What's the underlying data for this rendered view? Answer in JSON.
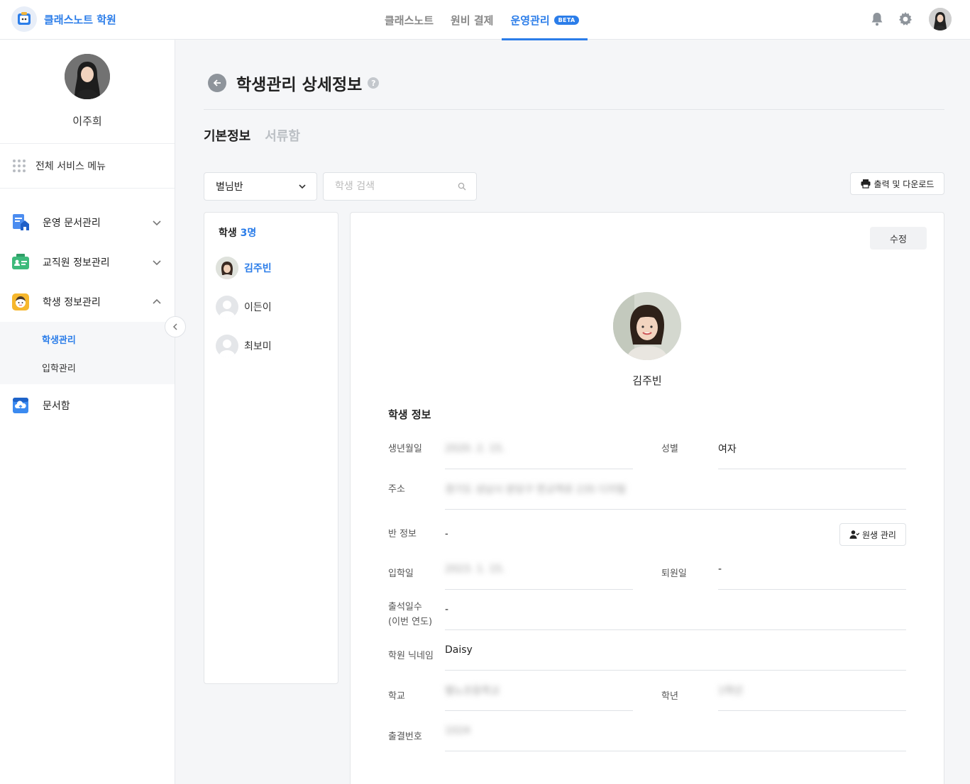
{
  "header": {
    "brand_name": "클래스노트 학원",
    "nav": [
      {
        "label": "클래스노트"
      },
      {
        "label": "원비 결제"
      },
      {
        "label": "운영관리"
      }
    ],
    "beta_badge": "BETA"
  },
  "sidebar": {
    "user_name": "이주희",
    "all_menu": "전체 서비스 메뉴",
    "items": [
      {
        "label": "운영 문서관리"
      },
      {
        "label": "교직원 정보관리"
      },
      {
        "label": "학생 정보관리"
      },
      {
        "label": "문서함"
      }
    ],
    "sub_items": [
      {
        "label": "학생관리"
      },
      {
        "label": "입학관리"
      }
    ]
  },
  "page": {
    "title": "학생관리 상세정보",
    "help": "?",
    "tabs": [
      {
        "label": "기본정보"
      },
      {
        "label": "서류함"
      }
    ],
    "class_filter": "별님반",
    "search_placeholder": "학생 검색",
    "print_button": "출력 및 다운로드"
  },
  "student_list": {
    "header_prefix": "학생",
    "count": "3명",
    "students": [
      {
        "name": "김주빈"
      },
      {
        "name": "이든이"
      },
      {
        "name": "최보미"
      }
    ]
  },
  "detail": {
    "edit_button": "수정",
    "name": "김주빈",
    "section_title": "학생 정보",
    "fields": {
      "birth_label": "생년월일",
      "birth_value": "2020. 2. 15.",
      "gender_label": "성별",
      "gender_value": "여자",
      "address_label": "주소",
      "address_value": "경기도 성남시 분당구 판교역로 235 디지털",
      "class_label": "반 정보",
      "class_value": "-",
      "class_mgmt_button": "원생 관리",
      "enroll_label": "입학일",
      "enroll_value": "2023. 1. 15.",
      "leave_label": "퇴원일",
      "leave_value": "-",
      "attendance_label_1": "출석일수",
      "attendance_label_2": "(이번 연도)",
      "attendance_value": "-",
      "nickname_label": "학원 닉네임",
      "nickname_value": "Daisy",
      "school_label": "학교",
      "school_value": "별노초등학교",
      "grade_label": "학년",
      "grade_value": "1학년",
      "attendance_no_label": "출결번호",
      "attendance_no_value": "1024"
    }
  },
  "colors": {
    "accent": "#2b7de9",
    "border": "#e3e5e8",
    "background": "#f5f6f8"
  },
  "icons": [
    "logo-icon",
    "bell-icon",
    "gear-icon",
    "grid-icon",
    "document-icon",
    "staff-card-icon",
    "student-face-icon",
    "folder-icon",
    "chevron-down-icon",
    "chevron-up-icon",
    "chevron-left-icon",
    "back-arrow-icon",
    "help-icon",
    "search-icon",
    "printer-icon",
    "user-manage-icon"
  ]
}
